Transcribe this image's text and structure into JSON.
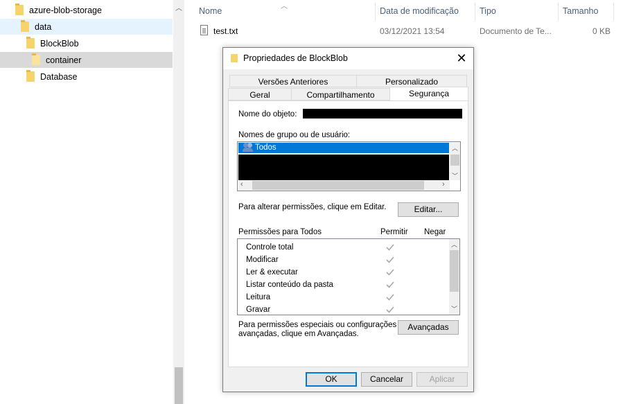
{
  "nav": {
    "items": [
      {
        "label": "azure-blob-storage"
      },
      {
        "label": "data"
      },
      {
        "label": "BlockBlob"
      },
      {
        "label": "container"
      },
      {
        "label": "Database"
      }
    ]
  },
  "file_list": {
    "columns": [
      "Nome",
      "Data de modificação",
      "Tipo",
      "Tamanho"
    ],
    "rows": [
      {
        "name": "test.txt",
        "modified": "03/12/2021 13:54",
        "type": "Documento de Te...",
        "size": "0 KB"
      }
    ]
  },
  "dialog": {
    "title": "Propriedades de BlockBlob",
    "close_glyph": "✕",
    "tabs_row1": [
      "Versões Anteriores",
      "Personalizado"
    ],
    "tabs_row2": [
      "Geral",
      "Compartilhamento",
      "Segurança"
    ],
    "active_tab": "Segurança",
    "object_name_label": "Nome do objeto:",
    "group_label": "Nomes de grupo ou de usuário:",
    "selected_group": "Todos",
    "change_hint": "Para alterar permissões, clique em Editar.",
    "edit_button": "Editar...",
    "permissions_header": "Permissões para Todos",
    "allow_header": "Permitir",
    "deny_header": "Negar",
    "permissions": [
      {
        "name": "Controle total",
        "allow": true,
        "deny": false
      },
      {
        "name": "Modificar",
        "allow": true,
        "deny": false
      },
      {
        "name": "Ler & executar",
        "allow": true,
        "deny": false
      },
      {
        "name": "Listar conteúdo da pasta",
        "allow": true,
        "deny": false
      },
      {
        "name": "Leitura",
        "allow": true,
        "deny": false
      },
      {
        "name": "Gravar",
        "allow": true,
        "deny": false
      }
    ],
    "advanced_hint_line1": "Para permissões especiais ou configurações",
    "advanced_hint_line2": "avançadas, clique em Avançadas.",
    "advanced_button": "Avançadas",
    "ok_button": "OK",
    "cancel_button": "Cancelar",
    "apply_button": "Aplicar"
  },
  "colors": {
    "accent": "#0078d7",
    "header_text": "#4c607a",
    "folder": "#f7d36b",
    "check_gray": "#a8a8a8"
  }
}
